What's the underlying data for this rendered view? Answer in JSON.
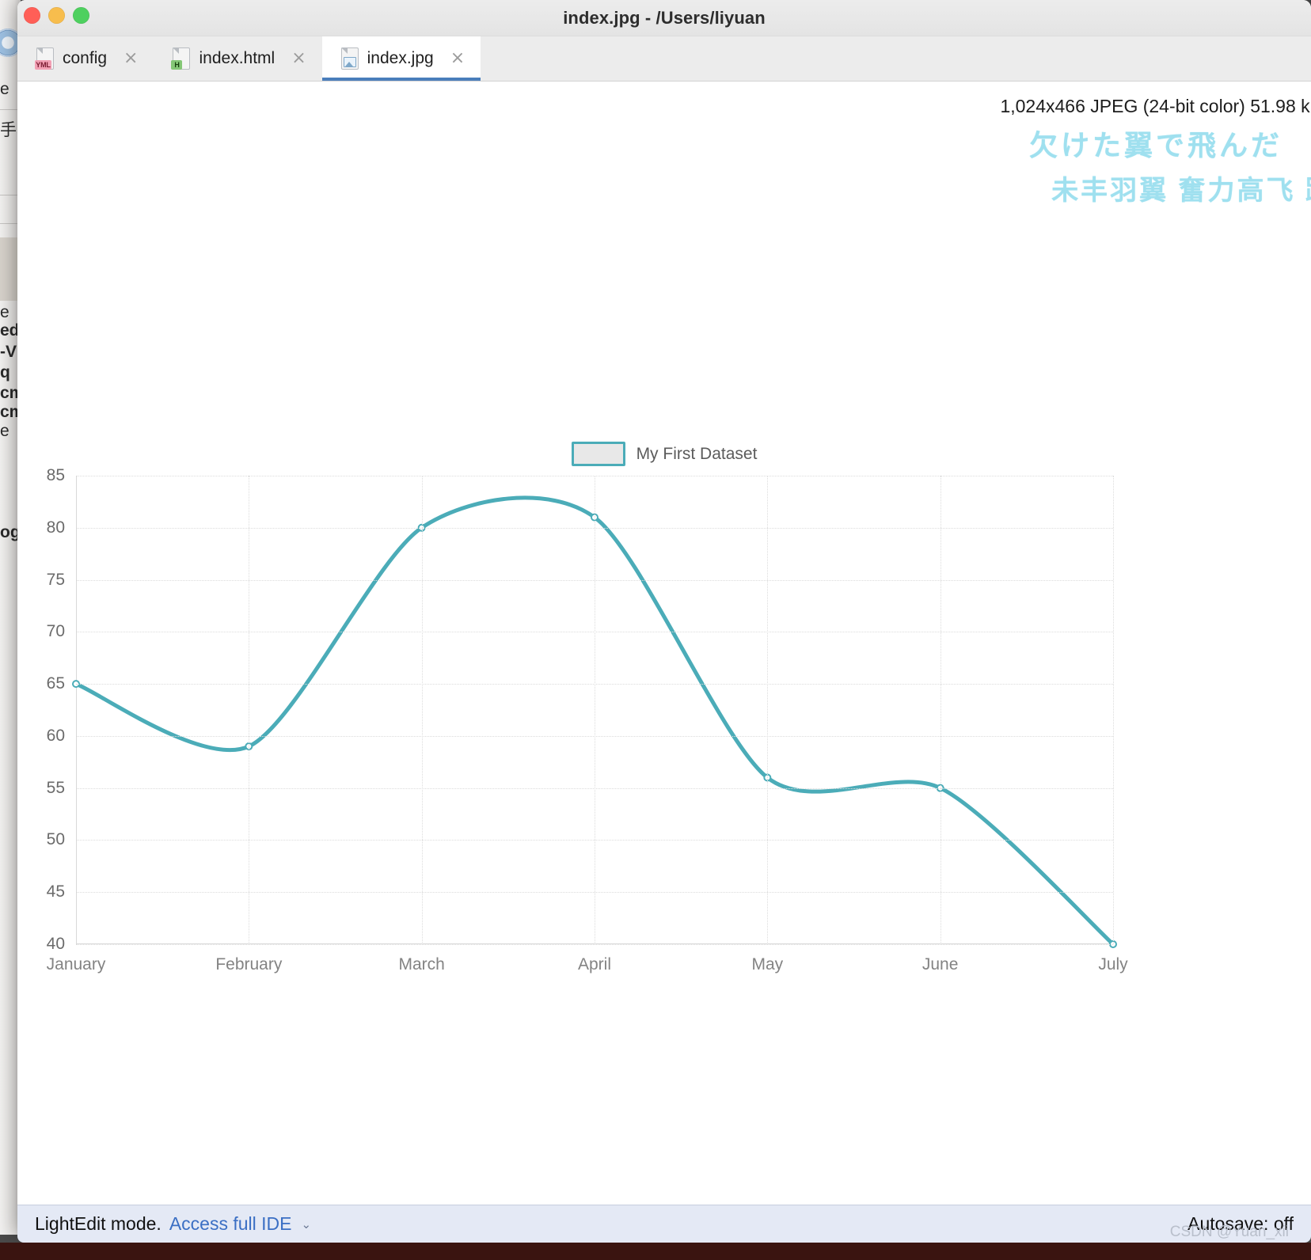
{
  "window": {
    "title": "index.jpg - /Users/liyuan",
    "traffic_lights": [
      "close-button",
      "minimize-button",
      "zoom-button"
    ]
  },
  "tabs": [
    {
      "label": "config",
      "icon": "yml-file-icon",
      "badge": "YML",
      "active": false,
      "close": "×"
    },
    {
      "label": "index.html",
      "icon": "html-file-icon",
      "badge": "H",
      "active": false,
      "close": "×"
    },
    {
      "label": "index.jpg",
      "icon": "image-file-icon",
      "badge": "",
      "active": true,
      "close": "×"
    }
  ],
  "viewer": {
    "image_info": "1,024x466 JPEG (24-bit color) 51.98 kB",
    "decoration_jp": "欠けた翼で飛んだ　酢",
    "decoration_cn": "未丰羽翼 奮力高飞 跋"
  },
  "statusbar": {
    "mode": "LightEdit mode.",
    "link": "Access full IDE",
    "chevron": "⌄",
    "autosave": "Autosave: off",
    "watermark": "CSDN @Yuan_xii"
  },
  "background_window": {
    "fragments": [
      "e",
      "手输",
      "e",
      "ed",
      "-V",
      "q",
      "cm",
      "cm",
      "e",
      "og"
    ]
  },
  "colors": {
    "line": "#4bacb8",
    "point_fill": "#ffffff",
    "legend_border": "#4bacb8",
    "tab_active_underline": "#4a7ebb",
    "status_link": "#3b6fc4",
    "decoration": "#9fe0ef"
  },
  "chart_data": {
    "type": "line",
    "title": "",
    "legend": [
      "My First Dataset"
    ],
    "legend_position": "top",
    "categories": [
      "January",
      "February",
      "March",
      "April",
      "May",
      "June",
      "July"
    ],
    "series": [
      {
        "name": "My First Dataset",
        "values": [
          65,
          59,
          80,
          81,
          56,
          55,
          40
        ]
      }
    ],
    "xlabel": "",
    "ylabel": "",
    "ylim": [
      40,
      85
    ],
    "yticks": [
      40,
      45,
      50,
      55,
      60,
      65,
      70,
      75,
      80,
      85
    ],
    "grid": true,
    "tension": 0.4,
    "line_color": "#4bacb8",
    "line_width": 5,
    "point_radius": 4
  }
}
